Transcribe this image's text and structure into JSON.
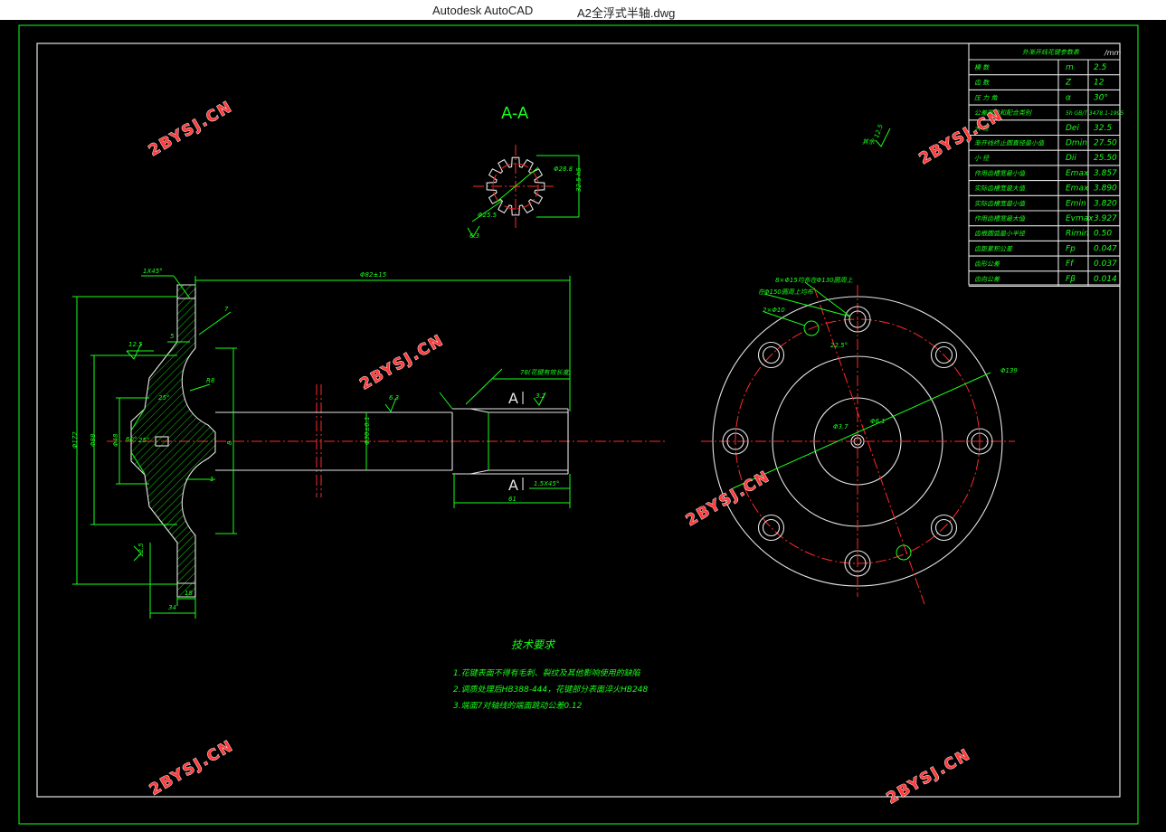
{
  "window": {
    "app": "Autodesk AutoCAD",
    "file": "A2全浮式半轴.dwg"
  },
  "colors": {
    "line": "#19ff19",
    "outline": "#e6e6e6",
    "center": "#ff2a2a",
    "background": "#000000"
  },
  "section_label": "A-A",
  "section_marks": [
    "A",
    "A"
  ],
  "spline_table": {
    "title": "外渐开线花键参数表",
    "unit": "/mm",
    "rows": [
      {
        "name": "模  数",
        "symbol": "m",
        "value": "2.5"
      },
      {
        "name": "齿  数",
        "symbol": "Z",
        "value": "12"
      },
      {
        "name": "压 力 角",
        "symbol": "α",
        "value": "30°"
      },
      {
        "name": "公差等级和配合类别",
        "symbol": "5h  GB/T 3478.1-1995",
        "value": ""
      },
      {
        "name": "大  径",
        "symbol": "Dei",
        "value": "32.5"
      },
      {
        "name": "渐开线终止圆直径最小值",
        "symbol": "Dmin",
        "value": "27.50"
      },
      {
        "name": "小  径",
        "symbol": "Dii",
        "value": "25.50"
      },
      {
        "name": "作用齿槽宽最小值",
        "symbol": "Emax",
        "value": "3.857"
      },
      {
        "name": "实际齿槽宽最大值",
        "symbol": "Emax",
        "value": "3.890"
      },
      {
        "name": "实际齿槽宽最小值",
        "symbol": "Emin",
        "value": "3.820"
      },
      {
        "name": "作用齿槽宽最大值",
        "symbol": "Evmax",
        "value": "3.927"
      },
      {
        "name": "齿根圆弧最小半径",
        "symbol": "Rimin",
        "value": "0.50"
      },
      {
        "name": "齿距累积公差",
        "symbol": "Fp",
        "value": "0.047"
      },
      {
        "name": "齿形公差",
        "symbol": "Ff",
        "value": "0.037"
      },
      {
        "name": "齿向公差",
        "symbol": "Fβ",
        "value": "0.014"
      }
    ]
  },
  "roughness_note": "其余",
  "roughness_value": "12.5",
  "dimensions": {
    "shaft_length": "Φ82±15",
    "spline_length": "78(花键有效长度)",
    "spline_end": "61",
    "chamfer": "1.5X45°",
    "flange_chamfer": "1X45°",
    "d_shaft": "Φ30±0.1",
    "d_flange": "Φ172",
    "d_hub": "Φ88",
    "d_bore": "Φ48",
    "r_fillet": "R8",
    "angle_cone": "60°",
    "angle_top": "25°",
    "w_total": "34",
    "w_flange": "18",
    "five": "5",
    "one": "1",
    "seven": "7",
    "eight": "8",
    "hole_note": "8×Φ15均布在Φ130圆周上",
    "hole_note2": "2×Φ10",
    "pitch_note": "在Φ150圆周上均布",
    "angle_22": "22.5°",
    "d_outer": "Φ139",
    "d_center": "Φ3.7",
    "d_center2": "Φ6.1",
    "sec_d1": "Φ28.8",
    "sec_d2": "Φ25.5",
    "sec_d3": "32.5 h5",
    "r63": "6.3",
    "r32": "3.2",
    "r125": "12.5",
    "r125b": "12.5",
    "r63b": "6.3"
  },
  "notes": {
    "title": "技术要求",
    "items": [
      "1.花键表面不得有毛刺、裂纹及其他影响使用的缺陷",
      "2.调质处理后HB388-444，花键部分表面淬火HB248",
      "3.端面7对轴线的端面跳动公差0.12"
    ]
  },
  "watermark": "2BYSJ.CN"
}
